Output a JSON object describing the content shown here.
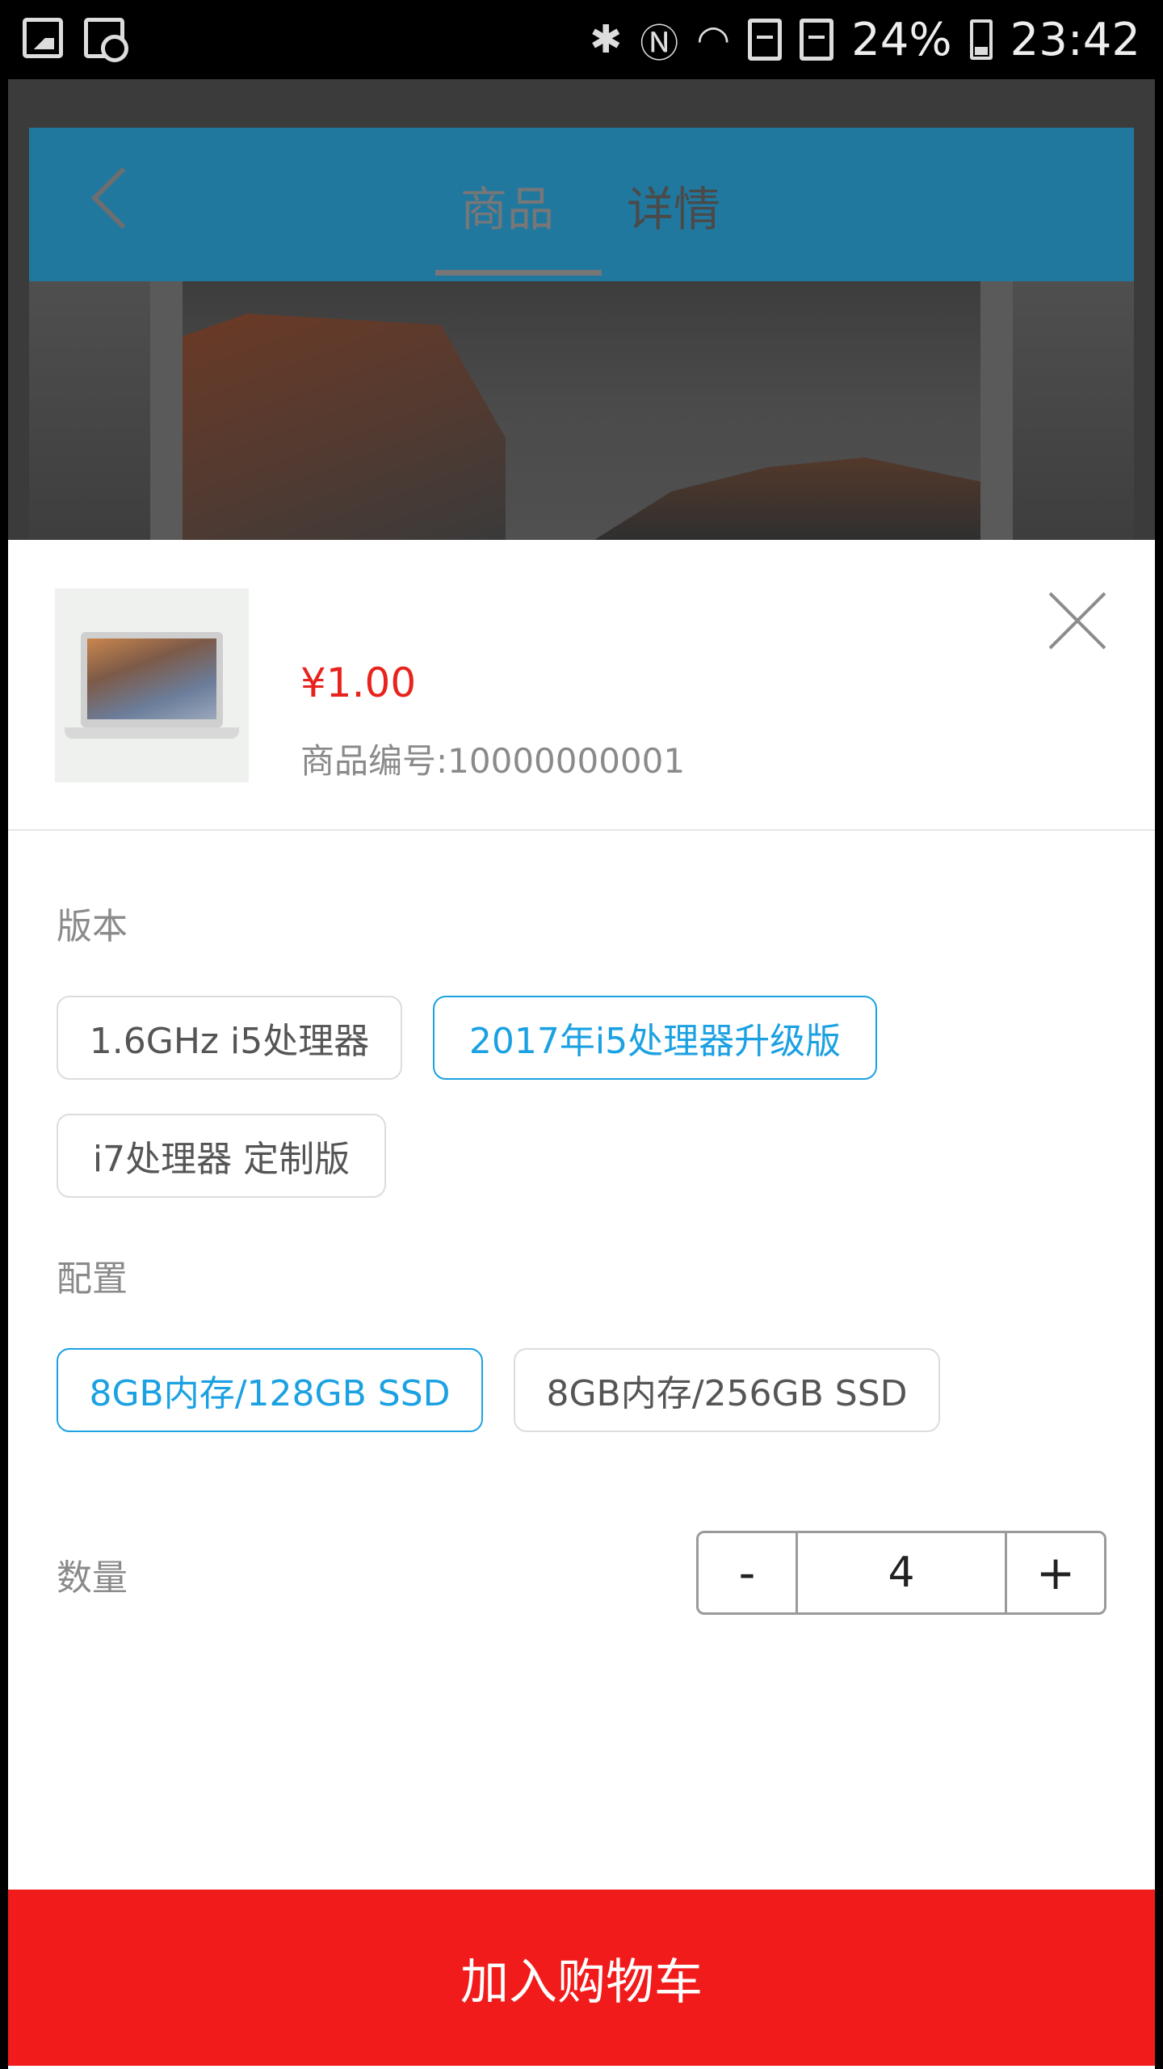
{
  "status_bar": {
    "battery": "24%",
    "time": "23:42"
  },
  "background_page": {
    "tabs": [
      {
        "label": "商品"
      },
      {
        "label": "详情"
      }
    ]
  },
  "product": {
    "price": "¥1.00",
    "sku": "商品编号:10000000001"
  },
  "version": {
    "label": "版本",
    "options": [
      {
        "label": "1.6GHz i5处理器",
        "selected": false
      },
      {
        "label": "2017年i5处理器升级版",
        "selected": true
      },
      {
        "label": "i7处理器 定制版",
        "selected": false
      }
    ]
  },
  "config": {
    "label": "配置",
    "options": [
      {
        "label": "8GB内存/128GB SSD",
        "selected": true
      },
      {
        "label": "8GB内存/256GB SSD",
        "selected": false
      }
    ]
  },
  "quantity": {
    "label": "数量",
    "minus": "-",
    "value": "4",
    "plus": "+"
  },
  "add_to_cart": "加入购物车",
  "colors": {
    "price": "#e8231d",
    "selected": "#1ba1e2",
    "cart_button": "#f21b1b",
    "header": "#21789f"
  }
}
